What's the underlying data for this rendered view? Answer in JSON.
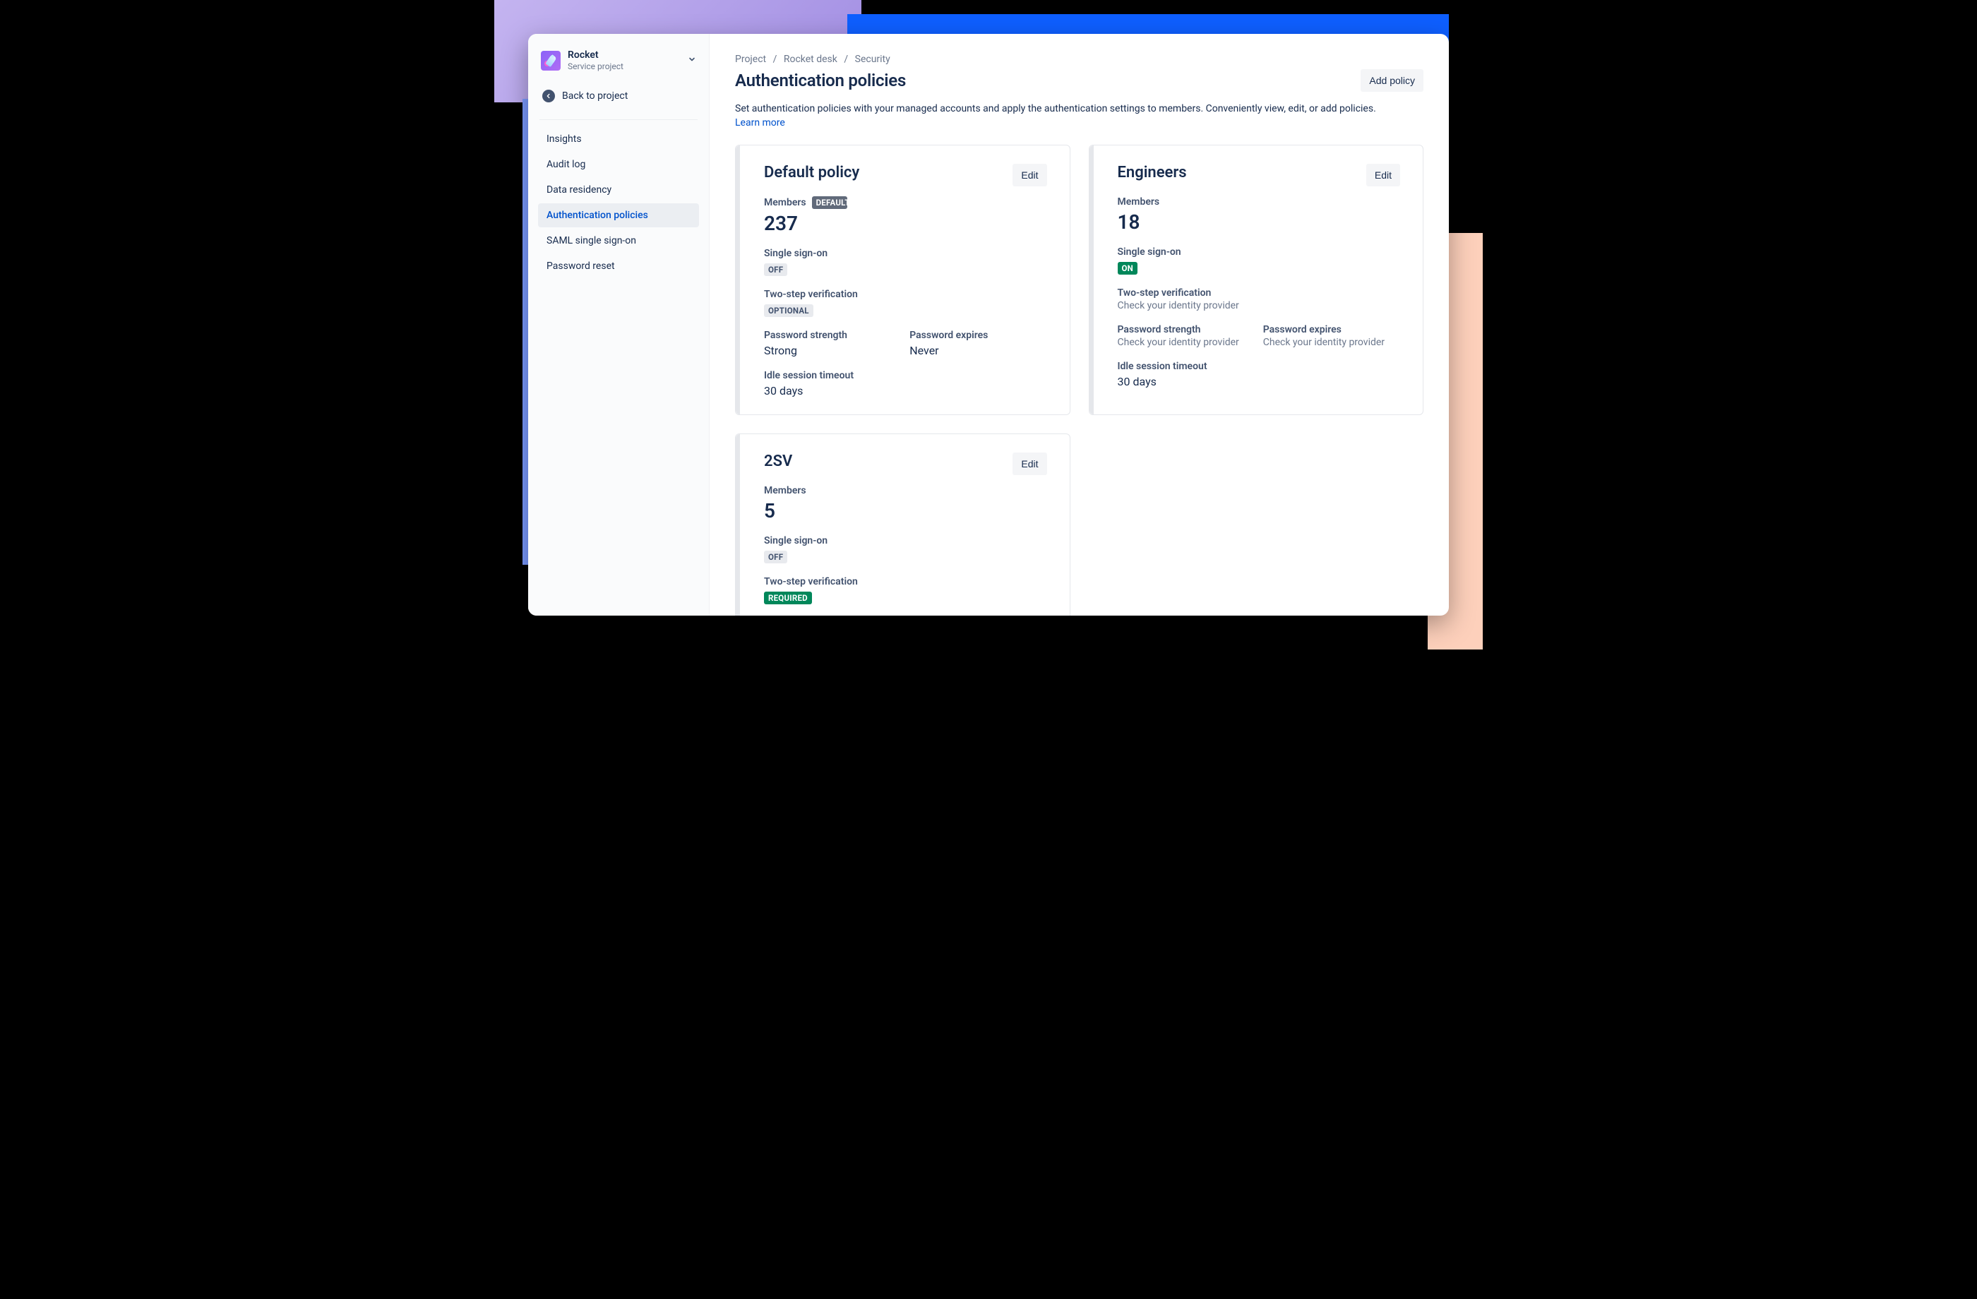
{
  "project": {
    "name": "Rocket",
    "subtitle": "Service project"
  },
  "sidebar": {
    "back_label": "Back to project",
    "items": [
      {
        "label": "Insights"
      },
      {
        "label": "Audit log"
      },
      {
        "label": "Data residency"
      },
      {
        "label": "Authentication policies"
      },
      {
        "label": "SAML single sign-on"
      },
      {
        "label": "Password reset"
      }
    ],
    "active_index": 3
  },
  "breadcrumbs": [
    "Project",
    "Rocket desk",
    "Security"
  ],
  "header": {
    "title": "Authentication policies",
    "add_policy": "Add policy",
    "description": "Set authentication policies with your managed accounts and apply the authentication settings to members. Conveniently view, edit, or add policies. ",
    "learn_more": "Learn more"
  },
  "edit_label": "Edit",
  "labels": {
    "members": "Members",
    "sso": "Single sign-on",
    "tsv": "Two-step verification",
    "pw_strength": "Password strength",
    "pw_expires": "Password expires",
    "idle": "Idle session timeout",
    "check_idp": "Check your identity provider",
    "default_badge": "DEFAULT"
  },
  "policies": [
    {
      "name": "Default policy",
      "is_default": true,
      "members": 237,
      "sso_badge": {
        "text": "OFF",
        "style": "gray"
      },
      "tsv_badge": {
        "text": "OPTIONAL",
        "style": "gray"
      },
      "pw_strength": "Strong",
      "pw_expires": "Never",
      "idle": "30 days"
    },
    {
      "name": "Engineers",
      "is_default": false,
      "members": 18,
      "sso_badge": {
        "text": "ON",
        "style": "green"
      },
      "tsv_note": true,
      "pw_note": true,
      "idle": "30 days"
    },
    {
      "name": "2SV",
      "is_default": false,
      "members": 5,
      "sso_badge": {
        "text": "OFF",
        "style": "gray"
      },
      "tsv_badge": {
        "text": "REQUIRED",
        "style": "green"
      }
    }
  ]
}
